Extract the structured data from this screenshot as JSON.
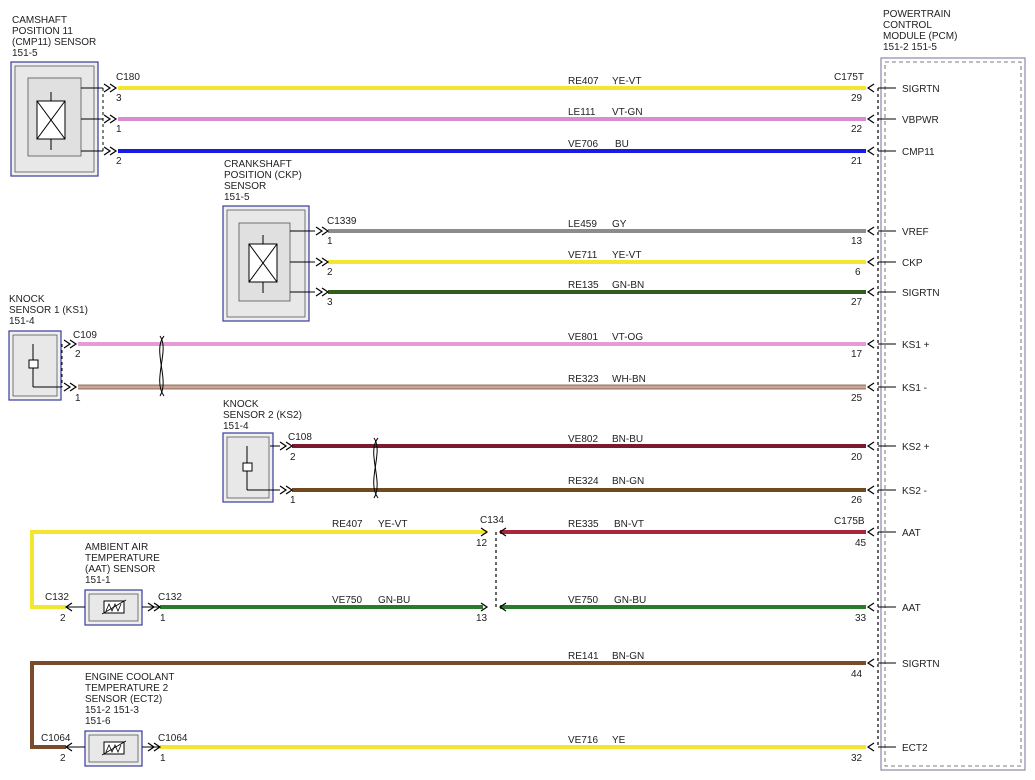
{
  "pcm": {
    "title": [
      "POWERTRAIN",
      "CONTROL",
      "MODULE (PCM)"
    ],
    "refs": "151-2  151-5",
    "pins": [
      "SIGRTN",
      "VBPWR",
      "CMP11",
      "VREF",
      "CKP",
      "SIGRTN",
      "KS1 +",
      "KS1 -",
      "KS2 +",
      "KS2 -",
      "AAT",
      "AAT",
      "SIGRTN",
      "ECT2"
    ]
  },
  "components": {
    "cmp": {
      "lines": [
        "CAMSHAFT",
        "POSITION 11",
        "(CMP11) SENSOR",
        "151-5"
      ]
    },
    "ckp": {
      "lines": [
        "CRANKSHAFT",
        "POSITION (CKP)",
        "SENSOR",
        "151-5"
      ]
    },
    "ks1": {
      "lines": [
        "KNOCK",
        "SENSOR 1 (KS1)",
        "151-4"
      ]
    },
    "ks2": {
      "lines": [
        "KNOCK",
        "SENSOR 2 (KS2)",
        "151-4"
      ]
    },
    "aat": {
      "lines": [
        "AMBIENT AIR",
        "TEMPERATURE",
        "(AAT) SENSOR",
        "151-1"
      ]
    },
    "ect": {
      "lines": [
        "ENGINE COOLANT",
        "TEMPERATURE 2",
        "SENSOR (ECT2)",
        "151-2  151-3",
        "151-6"
      ]
    }
  },
  "connectors": {
    "c180": "C180",
    "c175t": "C175T",
    "c1339": "C1339",
    "c109": "C109",
    "c108": "C108",
    "c134": "C134",
    "c175b": "C175B",
    "c132_a": "C132",
    "c132_b": "C132",
    "c1064_a": "C1064",
    "c1064_b": "C1064"
  },
  "circuits": [
    {
      "id": "RE407",
      "color_name": "YE-VT",
      "hex": "#f2e633",
      "left_pin": "3",
      "right_pin": "29"
    },
    {
      "id": "LE111",
      "color_name": "VT-GN",
      "hex": "#d98cd2",
      "left_pin": "1",
      "right_pin": "22"
    },
    {
      "id": "VE706",
      "color_name": "BU",
      "hex": "#1a1ae6",
      "left_pin": "2",
      "right_pin": "21"
    },
    {
      "id": "LE459",
      "color_name": "GY",
      "hex": "#8c8c8c",
      "left_pin": "1",
      "right_pin": "13"
    },
    {
      "id": "VE711",
      "color_name": "YE-VT",
      "hex": "#f2e633",
      "left_pin": "2",
      "right_pin": "6"
    },
    {
      "id": "RE135",
      "color_name": "GN-BN",
      "hex": "#2f5e1a",
      "left_pin": "3",
      "right_pin": "27"
    },
    {
      "id": "VE801",
      "color_name": "VT-OG",
      "hex": "#e79ad8",
      "left_pin": "2",
      "right_pin": "17"
    },
    {
      "id": "RE323",
      "color_name": "WH-BN",
      "hex": "#c9a89a",
      "left_pin": "1",
      "right_pin": "25"
    },
    {
      "id": "VE802",
      "color_name": "BN-BU",
      "hex": "#7a1a2e",
      "left_pin": "2",
      "right_pin": "20"
    },
    {
      "id": "RE324",
      "color_name": "BN-GN",
      "hex": "#6e4a1e",
      "left_pin": "1",
      "right_pin": "26"
    },
    {
      "id": "RE407",
      "color_name": "YE-VT",
      "hex": "#f2e633",
      "left_pin": "2",
      "right_pin": "12"
    },
    {
      "id": "RE335",
      "color_name": "BN-VT",
      "hex": "#a8263a",
      "left_pin": "12",
      "right_pin": "45"
    },
    {
      "id": "VE750",
      "color_name": "GN-BU",
      "hex": "#2b7a2b",
      "left_pin": "1",
      "right_pin": "13"
    },
    {
      "id": "VE750",
      "color_name": "GN-BU",
      "hex": "#2b7a2b",
      "left_pin": "13",
      "right_pin": "33"
    },
    {
      "id": "RE141",
      "color_name": "BN-GN",
      "hex": "#7a4a2a",
      "left_pin": "2",
      "right_pin": "44"
    },
    {
      "id": "VE716",
      "color_name": "YE",
      "hex": "#f2e633",
      "left_pin": "1",
      "right_pin": "32"
    }
  ]
}
